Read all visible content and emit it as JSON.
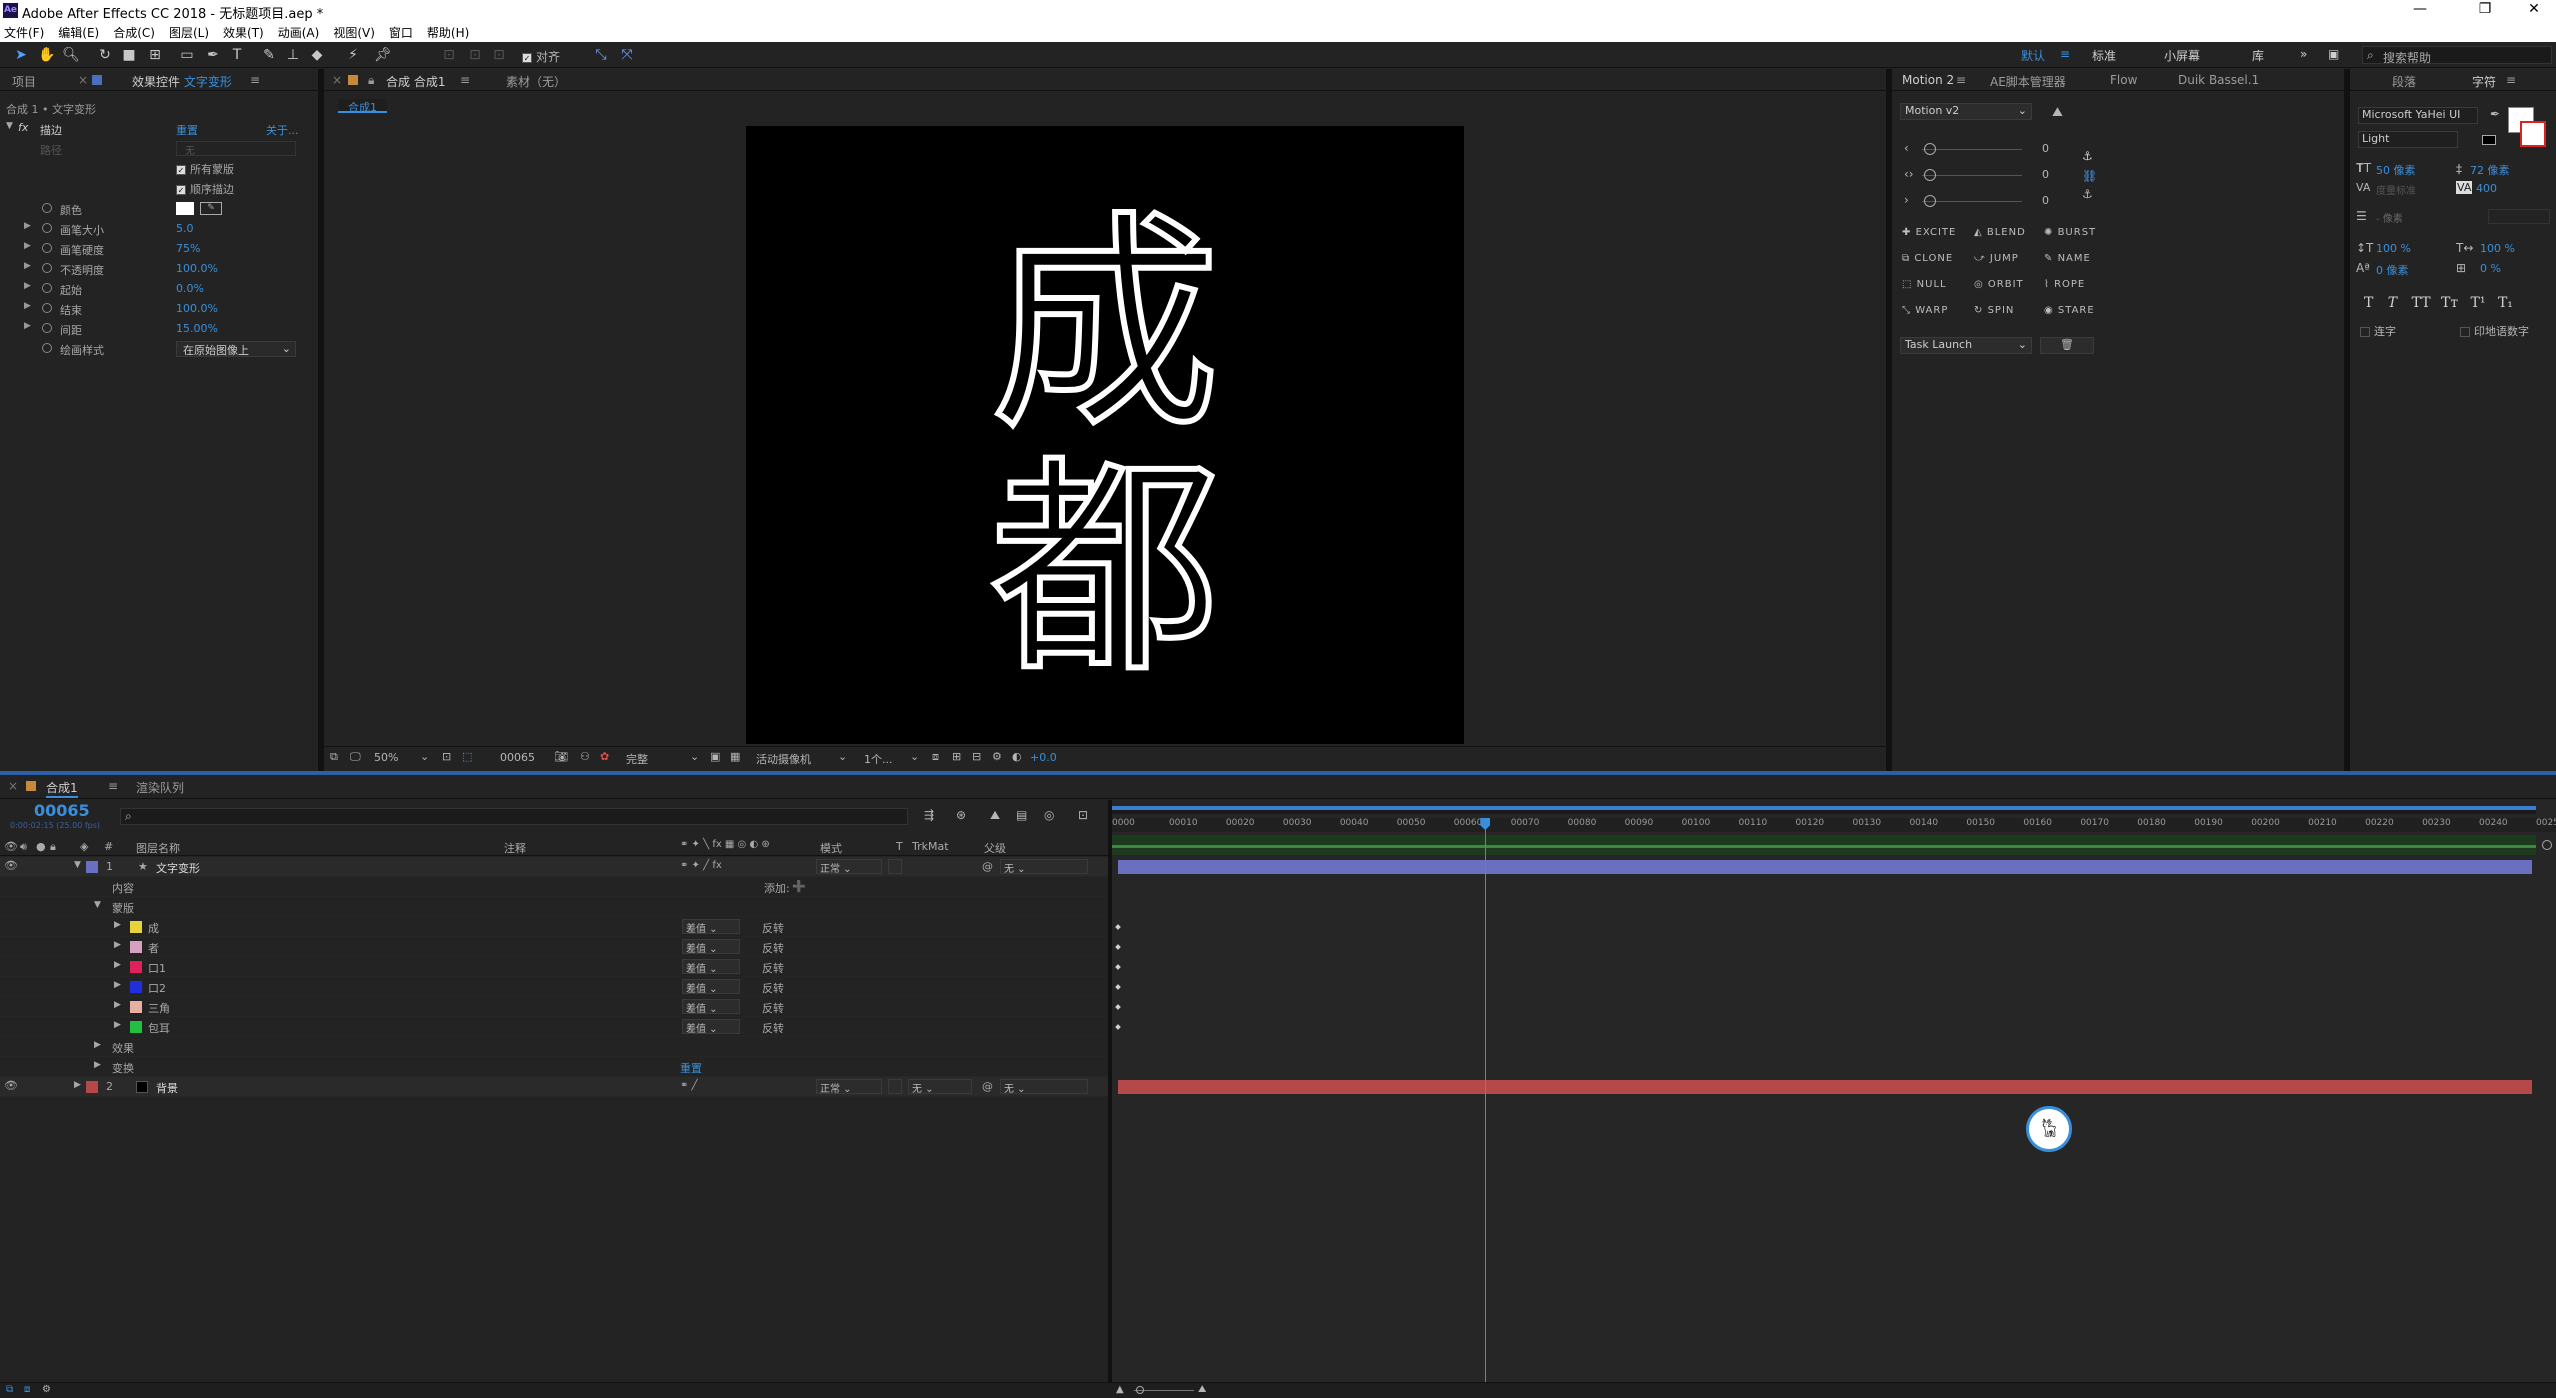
{
  "window": {
    "title": "Adobe After Effects CC 2018 - 无标题项目.aep *",
    "app_icon": "Ae"
  },
  "menu": [
    "文件(F)",
    "编辑(E)",
    "合成(C)",
    "图层(L)",
    "效果(T)",
    "动画(A)",
    "视图(V)",
    "窗口",
    "帮助(H)"
  ],
  "toolbar": {
    "snap_label": "对齐",
    "workspaces": [
      "默认",
      "标准",
      "小屏幕",
      "库"
    ],
    "search_placeholder": "搜索帮助"
  },
  "left_panel": {
    "tabs": [
      "项目",
      "效果控件",
      "文字变形"
    ],
    "breadcrumb": "合成 1 • 文字变形",
    "effect_name": "描边",
    "reset": "重置",
    "about": "关于...",
    "path_label": "路径",
    "path_value": "无",
    "all_masks": "所有蒙版",
    "sequential": "顺序描边",
    "props": [
      {
        "label": "颜色",
        "value": ""
      },
      {
        "label": "画笔大小",
        "value": "5.0"
      },
      {
        "label": "画笔硬度",
        "value": "75%"
      },
      {
        "label": "不透明度",
        "value": "100.0%"
      },
      {
        "label": "起始",
        "value": "0.0%"
      },
      {
        "label": "结束",
        "value": "100.0%"
      },
      {
        "label": "间距",
        "value": "15.00%"
      },
      {
        "label": "绘画样式",
        "value": "在原始图像上"
      }
    ]
  },
  "comp_panel": {
    "tab_label": "合成 合成1",
    "footage_label": "素材（无）",
    "sub_tab": "合成1",
    "text_line1": "成",
    "text_line2": "都",
    "bottom": {
      "zoom": "50%",
      "timecode": "00065",
      "quality": "完整",
      "camera": "活动摄像机",
      "views": "1个...",
      "exposure": "+0.0"
    }
  },
  "motion_panel": {
    "tabs": [
      "Motion 2",
      "AE脚本管理器",
      "Flow",
      "Duik Bassel.1"
    ],
    "version": "Motion v2",
    "sliders": [
      "0",
      "0",
      "0"
    ],
    "buttons": [
      "EXCITE",
      "BLEND",
      "BURST",
      "CLONE",
      "JUMP",
      "NAME",
      "NULL",
      "ORBIT",
      "ROPE",
      "WARP",
      "SPIN",
      "STARE"
    ],
    "launch": "Task Launch"
  },
  "char_panel": {
    "tabs": [
      "段落",
      "字符"
    ],
    "font": "Microsoft YaHei UI",
    "style": "Light",
    "size": "50 像素",
    "leading": "72 像素",
    "tracking_label": "度量标准",
    "tracking": "400",
    "stroke_label": "- 像素",
    "vscale": "100 %",
    "hscale": "100 %",
    "baseline": "0 像素",
    "tsume": "0 %",
    "style_buttons": [
      "T",
      "T",
      "TT",
      "Tт",
      "T¹",
      "T₁"
    ],
    "ligature": "连字",
    "hindi": "印地语数字"
  },
  "timeline": {
    "tabs": [
      "合成1",
      "渲染队列"
    ],
    "timecode": "00065",
    "sub_timecode": "0:00:02:15 (25.00 fps)",
    "headers": {
      "layer_name": "图层名称",
      "comment": "注释",
      "mode": "模式",
      "trkmat": "TrkMat",
      "parent": "父级"
    },
    "layers": [
      {
        "num": "1",
        "name": "文字变形",
        "mode": "正常",
        "parent": "无"
      },
      {
        "num": "2",
        "name": "背景",
        "mode": "正常",
        "trk": "无",
        "parent": "无"
      }
    ],
    "content_label": "内容",
    "add_label": "添加:",
    "masks_label": "蒙版",
    "masks": [
      {
        "name": "成",
        "color": "#e8d23a"
      },
      {
        "name": "者",
        "color": "#d8a0c0"
      },
      {
        "name": "口1",
        "color": "#e0205a"
      },
      {
        "name": "口2",
        "color": "#2030e0"
      },
      {
        "name": "三角",
        "color": "#e8b0a0"
      },
      {
        "name": "包耳",
        "color": "#22c040"
      }
    ],
    "mask_mode": "差值",
    "invert": "反转",
    "effects_label": "效果",
    "transform_label": "变换",
    "transform_reset": "重置",
    "ruler": [
      "0000",
      "00010",
      "00020",
      "00030",
      "00040",
      "00050",
      "00060",
      "00070",
      "00080",
      "00090",
      "00100",
      "00110",
      "00120",
      "00130",
      "00140",
      "00150",
      "00160",
      "00170",
      "00180",
      "00190",
      "00200",
      "00210",
      "00220",
      "00230",
      "00240",
      "0025"
    ],
    "playhead_frame": 65,
    "total_frames": 250,
    "layer1_color": "#6a6fbf",
    "layer2_color": "#b54848"
  }
}
